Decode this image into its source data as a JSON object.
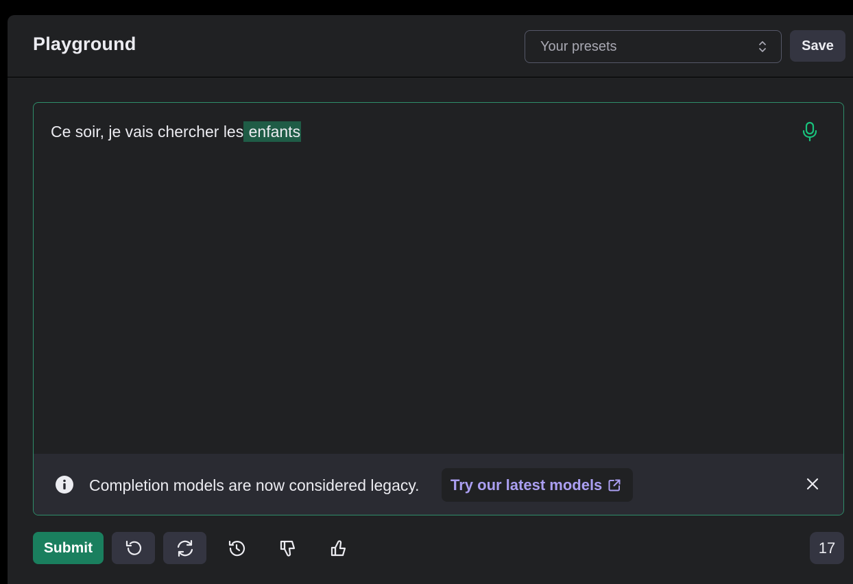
{
  "header": {
    "title": "Playground",
    "presets_placeholder": "Your presets",
    "save_label": "Save"
  },
  "editor": {
    "prompt_text": "Ce soir, je vais chercher les",
    "completion_text": " enfants",
    "mic_icon": "microphone-icon"
  },
  "banner": {
    "message": "Completion models are now considered legacy.",
    "link_label": "Try our latest models",
    "info_icon": "info-icon",
    "close_icon": "close-icon"
  },
  "footer": {
    "submit_label": "Submit",
    "undo_icon": "undo-icon",
    "regenerate_icon": "regenerate-icon",
    "history_icon": "history-icon",
    "thumbs_down_icon": "thumbs-down-icon",
    "thumbs_up_icon": "thumbs-up-icon",
    "token_count": "17"
  },
  "colors": {
    "background": "#202123",
    "accent": "#10a37f",
    "link": "#ab9ff2",
    "highlight": "#1f5c46"
  }
}
